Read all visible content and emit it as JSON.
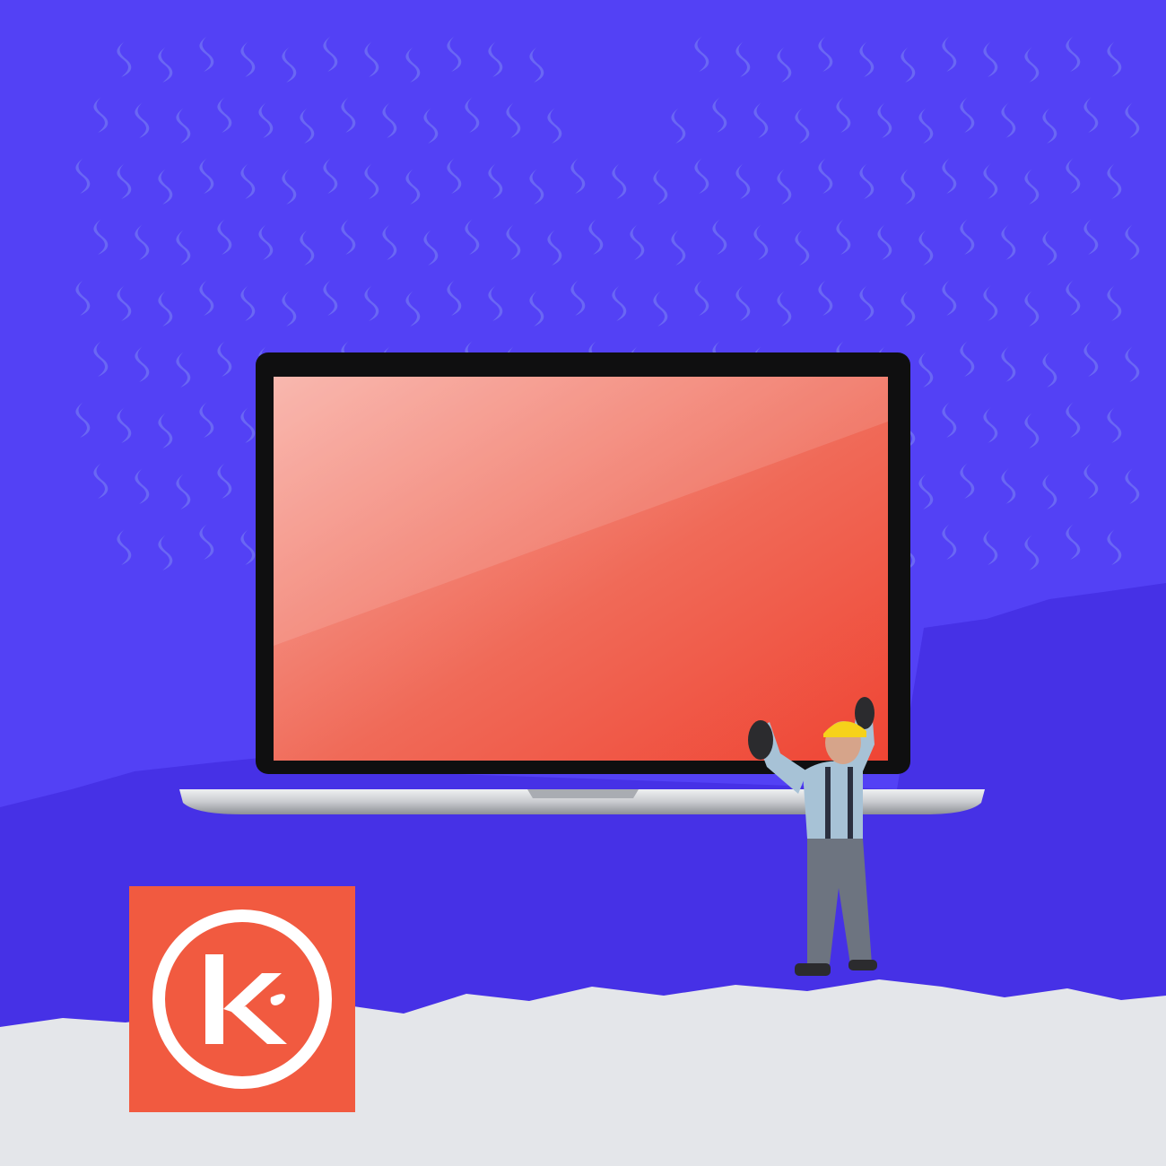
{
  "scene": {
    "colors": {
      "background_top": "#5341f5",
      "pattern": "#6e6cf4",
      "background_bottom": "#4631e6",
      "screen_red": "#ef4534",
      "screen_highlight": "#f8aea4",
      "laptop_bezel": "#0f0f10",
      "laptop_silver": "#c9cbcf",
      "paper": "#e4e6ea",
      "logo_red": "#f15a40",
      "logo_white": "#ffffff",
      "figure_shirt": "#a7c2d6",
      "figure_pants": "#6d7480",
      "helmet_yellow": "#f6d21a"
    },
    "icons": {
      "pattern": "flame-pattern-icon",
      "laptop": "laptop-icon",
      "figure": "construction-worker-figure",
      "logo": "k-logo-icon"
    }
  }
}
